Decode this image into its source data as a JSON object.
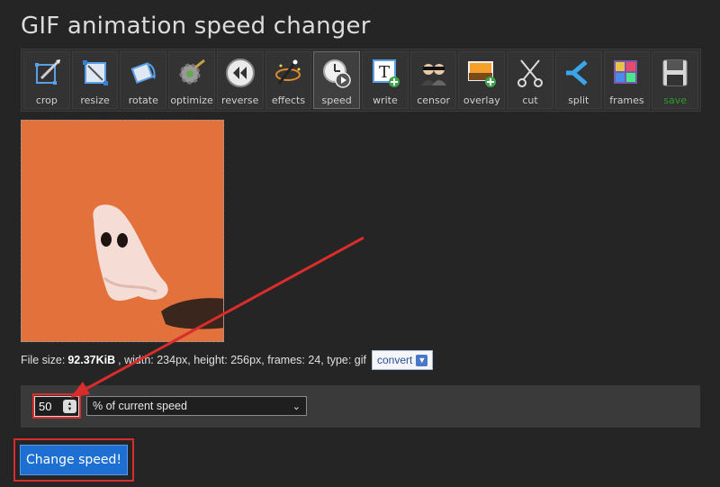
{
  "header": {
    "title": "GIF animation speed changer"
  },
  "toolbar": {
    "tools": [
      {
        "id": "crop",
        "label": "crop",
        "icon": "crop-icon"
      },
      {
        "id": "resize",
        "label": "resize",
        "icon": "resize-icon"
      },
      {
        "id": "rotate",
        "label": "rotate",
        "icon": "rotate-icon"
      },
      {
        "id": "optimize",
        "label": "optimize",
        "icon": "optimize-icon"
      },
      {
        "id": "reverse",
        "label": "reverse",
        "icon": "reverse-icon"
      },
      {
        "id": "effects",
        "label": "effects",
        "icon": "effects-icon"
      },
      {
        "id": "speed",
        "label": "speed",
        "icon": "speed-icon",
        "active": true
      },
      {
        "id": "write",
        "label": "write",
        "icon": "write-icon"
      },
      {
        "id": "censor",
        "label": "censor",
        "icon": "censor-icon"
      },
      {
        "id": "overlay",
        "label": "overlay",
        "icon": "overlay-icon"
      },
      {
        "id": "cut",
        "label": "cut",
        "icon": "cut-icon"
      },
      {
        "id": "split",
        "label": "split",
        "icon": "split-icon"
      },
      {
        "id": "frames",
        "label": "frames",
        "icon": "frames-icon"
      },
      {
        "id": "save",
        "label": "save",
        "icon": "save-icon"
      }
    ]
  },
  "file_info": {
    "label_size": "File size:",
    "size": "92.37KiB",
    "rest": ", width: 234px, height: 256px, frames: 24, type: gif",
    "convert_label": "convert"
  },
  "options": {
    "speed_value": "50",
    "unit_selected": "% of current speed"
  },
  "actions": {
    "change_label": "Change speed!"
  },
  "colors": {
    "accent": "#1d6fd2",
    "annotation": "#d92c2c",
    "preview_bg": "#e2713c"
  }
}
